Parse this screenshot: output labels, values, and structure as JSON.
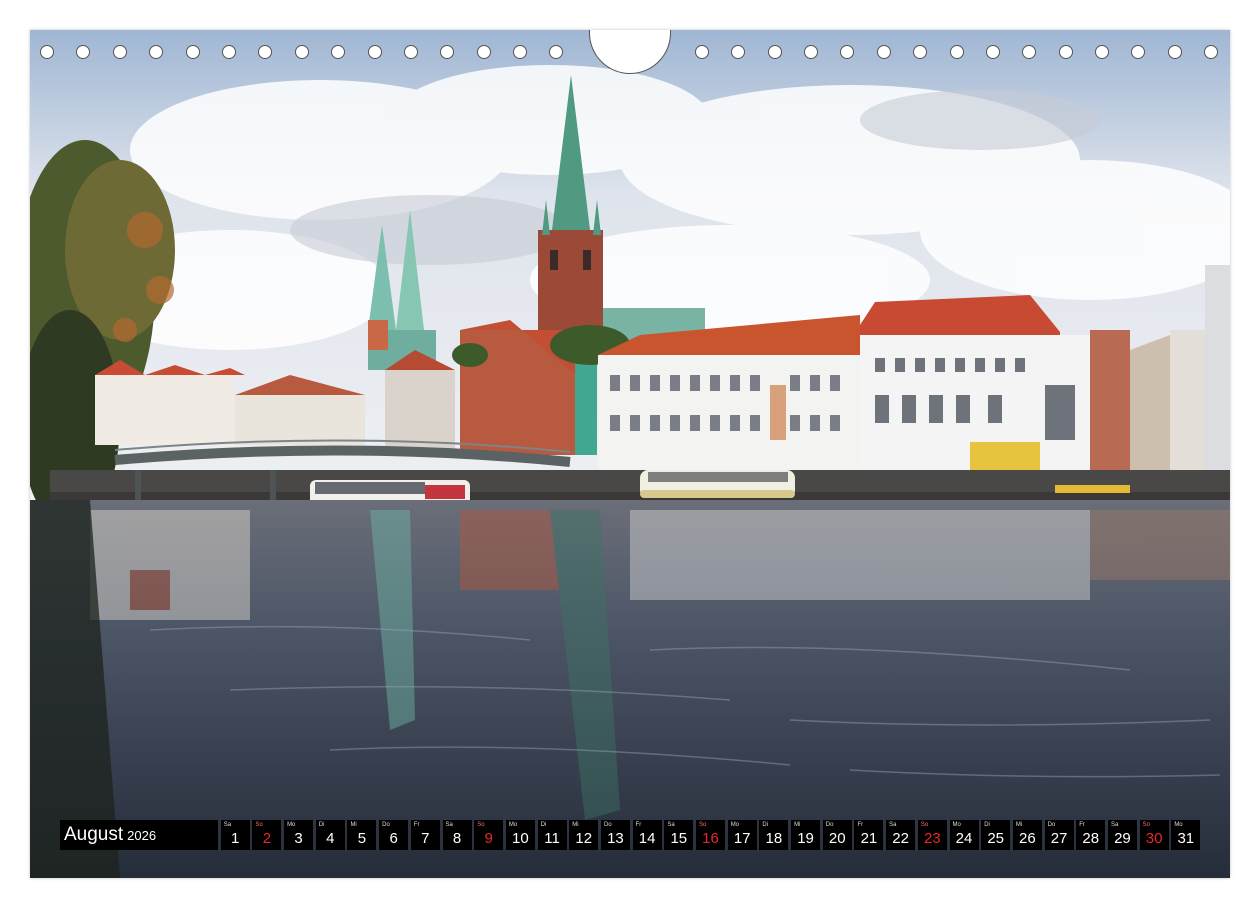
{
  "calendar": {
    "month": "August",
    "year": "2026",
    "days": [
      {
        "wd": "Sa",
        "n": "1"
      },
      {
        "wd": "So",
        "n": "2",
        "sunday": true
      },
      {
        "wd": "Mo",
        "n": "3"
      },
      {
        "wd": "Di",
        "n": "4"
      },
      {
        "wd": "Mi",
        "n": "5"
      },
      {
        "wd": "Do",
        "n": "6"
      },
      {
        "wd": "Fr",
        "n": "7"
      },
      {
        "wd": "Sa",
        "n": "8"
      },
      {
        "wd": "So",
        "n": "9",
        "sunday": true
      },
      {
        "wd": "Mo",
        "n": "10"
      },
      {
        "wd": "Di",
        "n": "11"
      },
      {
        "wd": "Mi",
        "n": "12"
      },
      {
        "wd": "Do",
        "n": "13"
      },
      {
        "wd": "Fr",
        "n": "14"
      },
      {
        "wd": "Sa",
        "n": "15"
      },
      {
        "wd": "So",
        "n": "16",
        "sunday": true
      },
      {
        "wd": "Mo",
        "n": "17"
      },
      {
        "wd": "Di",
        "n": "18"
      },
      {
        "wd": "Mi",
        "n": "19"
      },
      {
        "wd": "Do",
        "n": "20"
      },
      {
        "wd": "Fr",
        "n": "21"
      },
      {
        "wd": "Sa",
        "n": "22"
      },
      {
        "wd": "So",
        "n": "23",
        "sunday": true
      },
      {
        "wd": "Mo",
        "n": "24"
      },
      {
        "wd": "Di",
        "n": "25"
      },
      {
        "wd": "Mi",
        "n": "26"
      },
      {
        "wd": "Do",
        "n": "27"
      },
      {
        "wd": "Fr",
        "n": "28"
      },
      {
        "wd": "Sa",
        "n": "29"
      },
      {
        "wd": "So",
        "n": "30",
        "sunday": true
      },
      {
        "wd": "Mo",
        "n": "31"
      }
    ]
  },
  "colors": {
    "sky": "#c9d6e6",
    "water": "#3b4556",
    "sunday": "#e8262e",
    "bar": "#000000"
  }
}
